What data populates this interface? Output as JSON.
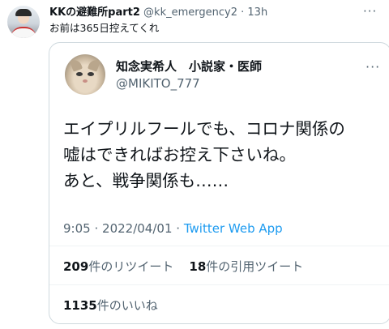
{
  "outer_tweet": {
    "display_name": "KKの避難所part2",
    "handle": "@kk_emergency2",
    "separator": "·",
    "time": "13h",
    "more_icon": "more-dots-icon",
    "text": "お前は365日控えてくれ"
  },
  "quoted_tweet": {
    "display_name": "知念実希人　小説家・医師",
    "handle": "@MIKITO_777",
    "more_icon": "more-dots-icon",
    "lines": [
      "エイプリルフールでも、コロナ関係の",
      "嘘はできればお控え下さいね。",
      "あと、戦争関係も……"
    ],
    "time": "9:05",
    "date_sep": "·",
    "date": "2022/04/01",
    "source_sep": "·",
    "source": "Twitter Web App",
    "retweets_count": "209",
    "retweets_label": "件のリツイート",
    "quotes_count": "18",
    "quotes_label": "件の引用ツイート",
    "likes_count": "1135",
    "likes_label": "件のいいね"
  },
  "colors": {
    "text": "#0f1419",
    "secondary": "#536471",
    "link": "#1d9bf0",
    "border": "#cfd9de"
  }
}
